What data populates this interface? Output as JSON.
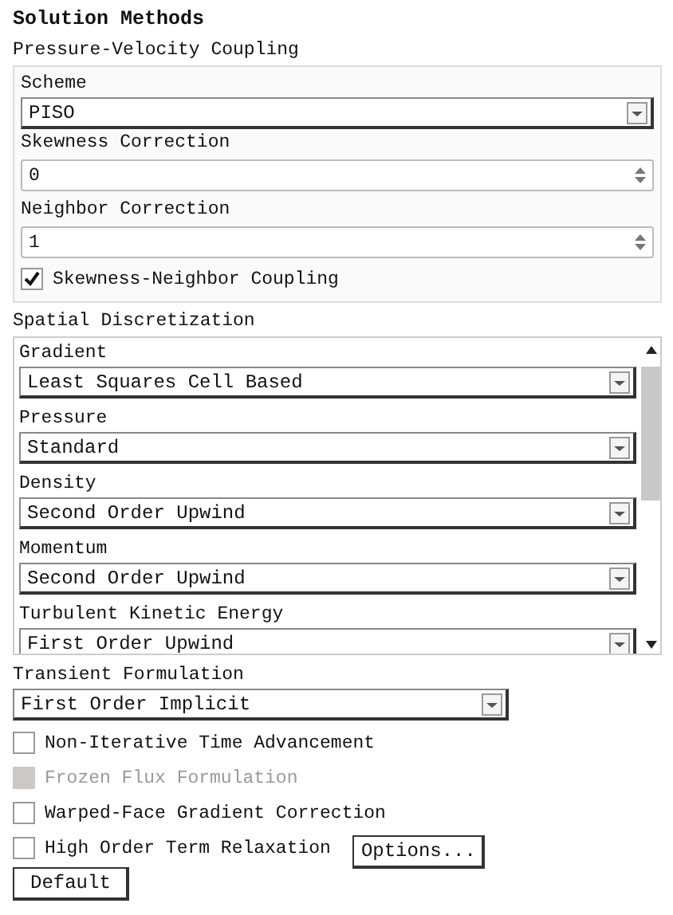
{
  "title": "Solution Methods",
  "pressure_velocity_coupling": {
    "heading": "Pressure-Velocity Coupling",
    "scheme": {
      "label": "Scheme",
      "value": "PISO"
    },
    "skewness_correction": {
      "label": "Skewness Correction",
      "value": "0"
    },
    "neighbor_correction": {
      "label": "Neighbor Correction",
      "value": "1"
    },
    "skewness_neighbor_coupling": {
      "label": "Skewness-Neighbor Coupling",
      "checked": true
    }
  },
  "spatial_discretization": {
    "heading": "Spatial Discretization",
    "items": [
      {
        "label": "Gradient",
        "value": "Least Squares Cell Based"
      },
      {
        "label": "Pressure",
        "value": "Standard"
      },
      {
        "label": "Density",
        "value": "Second Order Upwind"
      },
      {
        "label": "Momentum",
        "value": "Second Order Upwind"
      },
      {
        "label": "Turbulent Kinetic Energy",
        "value": "First Order Upwind"
      }
    ]
  },
  "transient_formulation": {
    "label": "Transient Formulation",
    "value": "First Order Implicit"
  },
  "options": [
    {
      "label": "Non-Iterative Time Advancement",
      "checked": false,
      "disabled": false
    },
    {
      "label": "Frozen Flux Formulation",
      "checked": false,
      "disabled": true
    },
    {
      "label": "Warped-Face Gradient Correction",
      "checked": false,
      "disabled": false
    },
    {
      "label": "High Order Term Relaxation",
      "checked": false,
      "disabled": false,
      "button": "Options..."
    }
  ],
  "default_button": "Default"
}
